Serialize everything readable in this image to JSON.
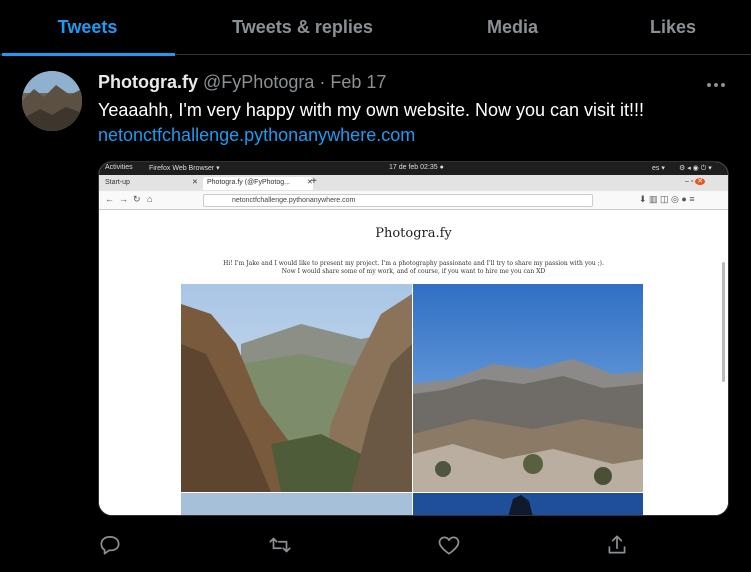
{
  "tabs": [
    {
      "label": "Tweets"
    },
    {
      "label": "Tweets & replies"
    },
    {
      "label": "Media"
    },
    {
      "label": "Likes"
    }
  ],
  "tweet": {
    "name": "Photogra.fy",
    "handle": "@FyPhotogra",
    "separator": " · ",
    "date": "Feb 17",
    "text": "Yeaaahh, I'm very happy with my own website. Now you can visit it!!!",
    "link": "netonctfchallenge.pythonanywhere.com",
    "more_icon": "more-horizontal-icon"
  },
  "screenshot": {
    "activities": "Activities",
    "app_menu": "Firefox Web Browser ▾",
    "clock": "17 de feb  02:35  ●",
    "lang": "es ▾",
    "tab_startup": "Start-up",
    "tab_site": "Photogra.fy (@FyPhotog...",
    "url": "netonctfchallenge.pythonanywhere.com",
    "site_title": "Photogra.fy",
    "intro_line1": "Hi! I'm Jake and I would like to present my project. I'm a photography passionate and I'll try to share my passion with you ;).",
    "intro_line2": "Now I would share some of my work, and of course, if you want to hire me you can XD"
  },
  "actions": [
    "reply-icon",
    "retweet-icon",
    "like-icon",
    "share-icon"
  ],
  "colors": {
    "accent": "#1d9bf0",
    "background": "#000000",
    "muted": "#8b9095"
  }
}
